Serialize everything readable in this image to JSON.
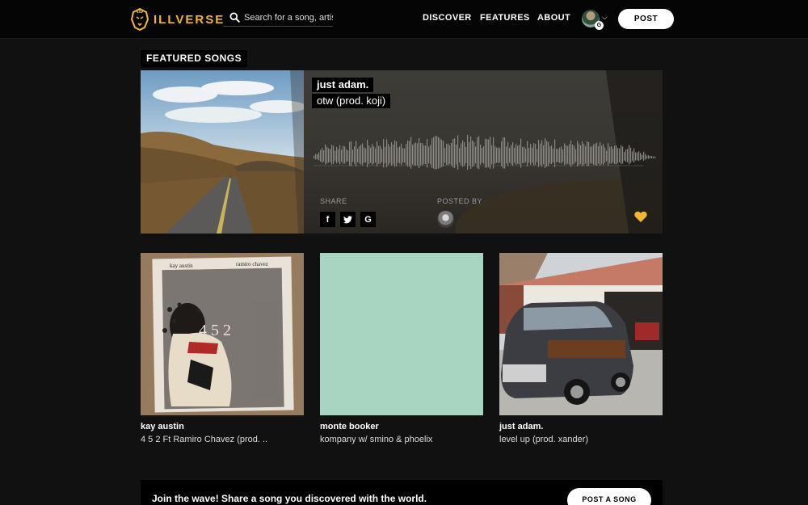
{
  "brand": {
    "name": "ILLVERSE",
    "accent": "#f2b632",
    "logo_icon": "lion-head-icon"
  },
  "search": {
    "placeholder": "Search for a song, artist",
    "icon": "search-icon"
  },
  "nav": {
    "links": [
      "DISCOVER",
      "FEATURES",
      "ABOUT"
    ],
    "avatar_badge": "G",
    "post_label": "POST"
  },
  "featured": {
    "section_title": "FEATURED SONGS",
    "artist": "just adam.",
    "title": "otw (prod. koji)",
    "share_label": "SHARE",
    "share_icons": [
      "f",
      "t",
      "G"
    ],
    "posted_by_label": "POSTED BY",
    "heart_color": "#f2b632"
  },
  "cards": [
    {
      "artist": "kay austin",
      "title": "4 5 2 Ft Ramiro Chavez (prod. ..",
      "art_text_left": "kay austin",
      "art_text_right": "ramiro chavez",
      "art_number": "4 5 2"
    },
    {
      "artist": "monte booker",
      "title": "kompany w/ smino & phoelix",
      "art_color": "#a8d5c2"
    },
    {
      "artist": "just adam.",
      "title": "level up (prod. xander)"
    }
  ],
  "cta": {
    "text": "Join the wave! Share a song you discovered with the world.",
    "button": "POST A SONG"
  }
}
